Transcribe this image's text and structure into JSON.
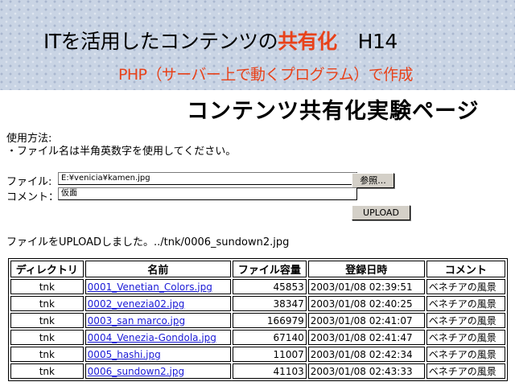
{
  "banner": {
    "title_main": "ITを活用したコンテンツの",
    "title_highlight": "共有化",
    "title_year": "H14",
    "subtitle": "PHP（サーバー上で動くプログラム）で作成"
  },
  "page": {
    "heading": "コンテンツ共有化実験ページ"
  },
  "usage": {
    "heading": "使用方法:",
    "note": "・ファイル名は半角英数字を使用してください。"
  },
  "form": {
    "file_label": "ファイル:",
    "file_value": "E:¥venicia¥kamen.jpg",
    "browse_label": "参照...",
    "comment_label": "コメント：",
    "comment_value": "仮面",
    "upload_label": "UPLOAD"
  },
  "status": {
    "message": "ファイルをUPLOADしました。../tnk/0006_sundown2.jpg"
  },
  "table": {
    "headers": [
      "ディレクトリ",
      "名前",
      "ファイル容量",
      "登録日時",
      "コメント"
    ],
    "rows": [
      {
        "dir": "tnk",
        "name": "0001_Venetian_Colors.jpg",
        "size": "45853",
        "date": "2003/01/08 02:39:51",
        "comment": "ベネチアの風景"
      },
      {
        "dir": "tnk",
        "name": "0002_venezia02.jpg",
        "size": "38347",
        "date": "2003/01/08 02:40:25",
        "comment": "ベネチアの風景"
      },
      {
        "dir": "tnk",
        "name": "0003_san marco.jpg",
        "size": "166979",
        "date": "2003/01/08 02:41:07",
        "comment": "ベネチアの風景"
      },
      {
        "dir": "tnk",
        "name": "0004_Venezia-Gondola.jpg",
        "size": "67140",
        "date": "2003/01/08 02:41:47",
        "comment": "ベネチアの風景"
      },
      {
        "dir": "tnk",
        "name": "0005_hashi.jpg",
        "size": "11007",
        "date": "2003/01/08 02:42:34",
        "comment": "ベネチアの風景"
      },
      {
        "dir": "tnk",
        "name": "0006_sundown2.jpg",
        "size": "41103",
        "date": "2003/01/08 02:43:33",
        "comment": "ベネチアの風景"
      }
    ]
  },
  "colors": {
    "accent": "#e8421a",
    "link": "#1a1ad6",
    "banner_bg": "#c9d4e4"
  }
}
